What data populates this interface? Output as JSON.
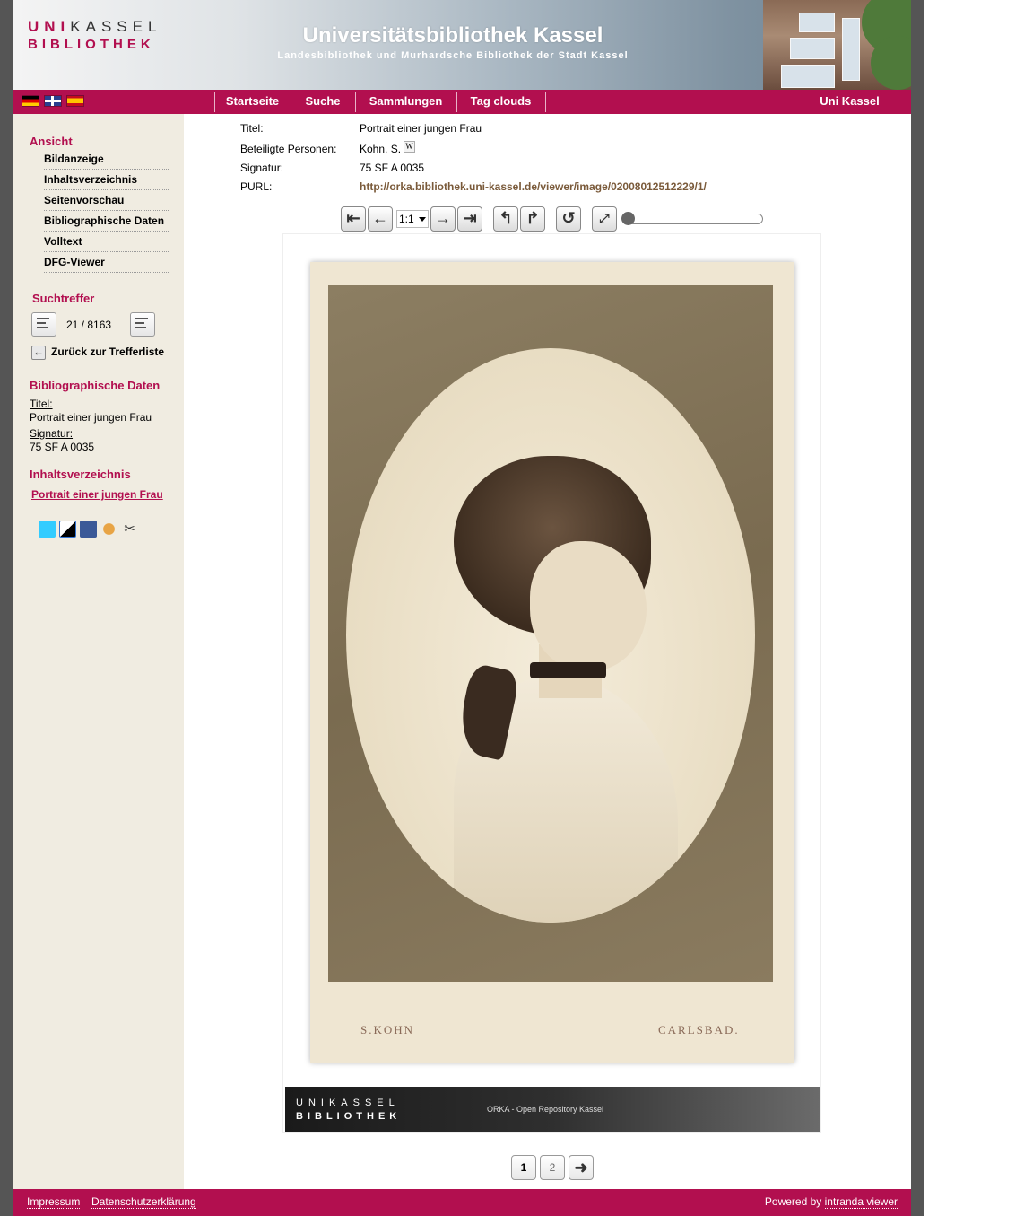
{
  "header": {
    "logo_line1_uni": "UNI",
    "logo_line1_rest": "KASSEL",
    "logo_line2": "BIBLIOTHEK",
    "title": "Universitätsbibliothek Kassel",
    "subtitle": "Landesbibliothek und Murhardsche Bibliothek der Stadt Kassel"
  },
  "nav": {
    "items": [
      "Startseite",
      "Suche",
      "Sammlungen",
      "Tag clouds"
    ],
    "right": "Uni Kassel",
    "flags": [
      "flag-de-icon",
      "flag-en-icon",
      "flag-es-icon"
    ]
  },
  "sidebar": {
    "ansicht_head": "Ansicht",
    "ansicht_items": [
      "Bildanzeige",
      "Inhaltsverzeichnis",
      "Seitenvorschau",
      "Bibliographische Daten",
      "Volltext",
      "DFG-Viewer"
    ],
    "suchtreffer_head": "Suchtreffer",
    "hit_count": "21 / 8163",
    "back_label": "Zurück zur Trefferliste",
    "biblio_head": "Bibliographische Daten",
    "titel_label": "Titel:",
    "titel_value": "Portrait einer jungen Frau",
    "signatur_label": "Signatur:",
    "signatur_value": "75 SF A 0035",
    "toc_head": "Inhaltsverzeichnis",
    "toc_link": "Portrait einer jungen Frau",
    "social_icons": [
      "twitter-icon",
      "delicious-icon",
      "facebook-icon",
      "mister-wong-icon",
      "bookmark-scissors-icon"
    ]
  },
  "meta": {
    "titel_label": "Titel:",
    "titel_value": "Portrait einer jungen Frau",
    "personen_label": "Beteiligte Personen:",
    "personen_value": "Kohn, S.",
    "wiki_badge": "W",
    "signatur_label": "Signatur:",
    "signatur_value": "75 SF A 0035",
    "purl_label": "PURL:",
    "purl_value": "http://orka.bibliothek.uni-kassel.de/viewer/image/02008012512229/1/"
  },
  "toolbar": {
    "zoom_value": "1:1",
    "zoom_level": 0
  },
  "image": {
    "caption_left": "S.KOHN",
    "caption_right": "CARLSBAD.",
    "banner_line1": "UNIKASSEL",
    "banner_line2": "BIBLIOTHEK",
    "banner_text": "ORKA - Open Repository Kassel"
  },
  "pagination": {
    "pages": [
      "1",
      "2"
    ],
    "current": "1"
  },
  "footer": {
    "impressum": "Impressum",
    "datenschutz": "Datenschutzerklärung",
    "powered_prefix": "Powered by",
    "powered_link": "intranda viewer"
  },
  "colors": {
    "brand": "#b20f4f",
    "sidebar_bg": "#f0ece1",
    "purl": "#7a5a3a"
  }
}
